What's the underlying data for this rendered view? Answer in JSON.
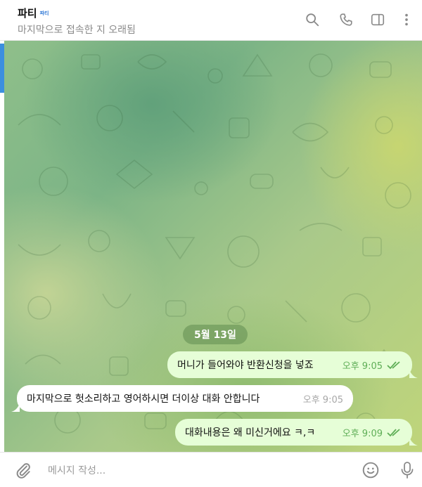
{
  "chat": {
    "title": "파티",
    "title_badge": "파티",
    "status": "마지막으로 접속한 지 오래됨"
  },
  "header_icons": [
    "search-icon",
    "phone-icon",
    "sidebar-toggle-icon",
    "more-vertical-icon"
  ],
  "date_separator": "5월 13일",
  "messages": [
    {
      "direction": "outgoing",
      "text": "머니가 들어와야 반환신청을 넣죠",
      "time": "오후 9:05",
      "read": true
    },
    {
      "direction": "incoming",
      "text": "마지막으로 헛소리하고 영어하시면 더이상 대화 안합니다",
      "time": "오후 9:05"
    },
    {
      "direction": "outgoing",
      "text": "대화내용은 왜 미신거에요 ㅋ,ㅋ",
      "time": "오후 9:09",
      "read": true
    }
  ],
  "composer": {
    "placeholder": "메시지 작성..."
  },
  "colors": {
    "outgoing_bubble": "#e6fed7",
    "incoming_bubble": "#ffffff",
    "check_color": "#5fae57",
    "accent": "#3c8fdf"
  }
}
